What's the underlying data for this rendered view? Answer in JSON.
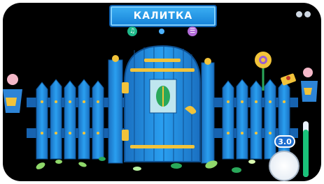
{
  "header": {
    "title": "КАЛИТКА"
  },
  "toolbar": {
    "sound_icon": "speaker-icon",
    "menu_icon": "menu-icon",
    "settings_icon": "settings-icon",
    "close_icon": "close-icon"
  },
  "zoom": {
    "value": "3.0",
    "slider_level": 0.85
  },
  "colors": {
    "fence": "#1e86d8",
    "gate": "#1e86d8",
    "hardware": "#f2c33a",
    "banner": "#2a9ae8"
  }
}
